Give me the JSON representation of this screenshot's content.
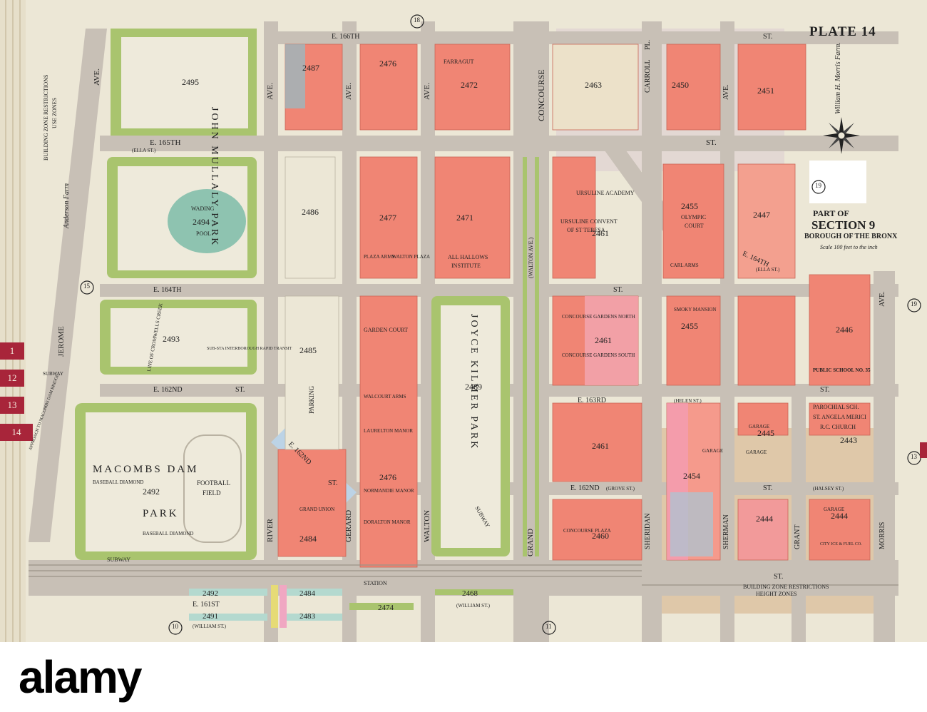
{
  "plate": {
    "title": "PLATE 14",
    "section": "PART OF",
    "section_name": "SECTION 9",
    "borough": "BOROUGH OF THE BRONX",
    "scale": "Scale 100 feet to the inch"
  },
  "farm_note_right": "William H. Morris Farm.",
  "farm_note_left": "Anderson Farm",
  "zone_left_title": "BUILDING ZONE RESTRICTIONS",
  "zone_left_sub": "USE ZONES",
  "zone_bottom_title": "BUILDING ZONE RESTRICTIONS",
  "zone_bottom_sub": "HEIGHT ZONES",
  "streets": {
    "e166": "E. 166TH",
    "st1": "ST.",
    "e165": "E. 165TH",
    "ella": "(ELLA ST.)",
    "st2": "ST.",
    "e164a": "E. 164TH",
    "e164b": "E. 164TH",
    "st3": "ST.",
    "ella2": "(ELLA ST.)",
    "e162a": "E. 162ND",
    "st4": "ST.",
    "e163": "E. 163RD",
    "helen": "(HELEN ST.)",
    "st5": "ST.",
    "e162b": "E. 162ND",
    "grove": "(GROVE ST.)",
    "st6": "ST.",
    "halsey": "(HALSEY ST.)",
    "e161": "E. 161ST",
    "william1": "(WILLIAM ST.)",
    "william2": "(WILLIAM ST.)",
    "st7": "ST.",
    "e162diag": "E. 162ND",
    "st8": "ST.",
    "jerome": "JEROME",
    "ave_jerome": "AVE.",
    "river": "RIVER",
    "ave_col2": "AVE.",
    "gerard": "GERARD",
    "ave_col3": "AVE.",
    "walton": "WALTON",
    "ave_col4": "AVE.",
    "concourse": "CONCOURSE",
    "grand": "GRAND",
    "walton_ave": "(WALTON AVE.)",
    "carroll": "CARROLL",
    "pl": "PL.",
    "sheridan": "SHERIDAN",
    "sherman": "SHERMAN",
    "grant": "GRANT",
    "morris": "MORRIS",
    "ave_col9": "AVE.",
    "ave_col10": "AVE.",
    "subway1": "SUBWAY",
    "subway2": "SUBWAY",
    "station": "STATION",
    "subway3": "SUBWAY"
  },
  "blocks": [
    "2495",
    "2487",
    "2476",
    "2472",
    "2463",
    "2450",
    "2451",
    "2494",
    "2486",
    "2477",
    "2471",
    "2461",
    "2455",
    "2447",
    "2493",
    "2485",
    "2469",
    "2461",
    "2455",
    "2446",
    "2492",
    "2484",
    "2476",
    "2461",
    "2454",
    "2445",
    "2443",
    "2460",
    "2444",
    "2444",
    "2492",
    "2484",
    "2483",
    "2491",
    "2474",
    "2468"
  ],
  "parks": {
    "john_mullaly": "JOHN MULLALY PARK",
    "macombs": "MACOMBS DAM",
    "park": "PARK",
    "joyce": "JOYCE KILMER PARK"
  },
  "places": {
    "wading": "WADING",
    "pool": "POOL",
    "baseball1": "BASEBALL DIAMOND",
    "baseball2": "BASEBALL DIAMOND",
    "football": "FOOTBALL",
    "field": "FIELD",
    "parking": "PARKING",
    "farragut": "FARRAGUT",
    "ursuline": "URSULINE ACADEMY",
    "convent": "URSULINE CONVENT",
    "theresa": "OF ST TERESA",
    "allhallows": "ALL HALLOWS",
    "institute": "INSTITUTE",
    "plaza_arms": "PLAZA ARMS",
    "walton_plaza": "WALTON PLAZA",
    "olympic": "OLYMPIC",
    "court": "COURT",
    "carl_arms": "CARL ARMS",
    "concourse_gardens_n": "CONCOURSE GARDENS NORTH",
    "concourse_gardens_s": "CONCOURSE GARDENS SOUTH",
    "garden_court": "GARDEN COURT",
    "walcourt": "WALCOURT ARMS",
    "laurelton": "LAURELTON MANOR",
    "normandie": "NORMANDIE MANOR",
    "doralton": "DORALTON MANOR",
    "grand_union": "GRAND UNION",
    "substa": "SUB-STA INTERBOROUGH RAPID TRANSIT",
    "public_school": "PUBLIC SCHOOL NO. 35",
    "parochial": "PAROCHIAL SCH.",
    "angela": "ST. ANGELA MERICI",
    "rc_church": "R.C. CHURCH",
    "garage1": "GARAGE",
    "garage2": "GARAGE",
    "garage3": "GARAGE",
    "garage4": "GARAGE",
    "concourse_plaza": "CONCOURSE PLAZA",
    "city_ice": "CITY ICE & FUEL CO.",
    "smoky": "SMOKY MANSION",
    "bridge_approach": "APPROACH TO MACOMBS DAM BRIDGE",
    "line": "LINE OF CROMWELLS CREEK"
  },
  "sheet_numbers": [
    "18",
    "19",
    "19",
    "15",
    "13",
    "10",
    "11"
  ],
  "tabs": [
    "1",
    "12",
    "13",
    "14"
  ],
  "watermark": "alamy",
  "colors": {
    "paper": "#ece7d6",
    "street": "#c8c0b6",
    "building": "#f08574",
    "park": "#a9c46e",
    "commercial": "#d8b38a",
    "tab": "#a8253a"
  }
}
